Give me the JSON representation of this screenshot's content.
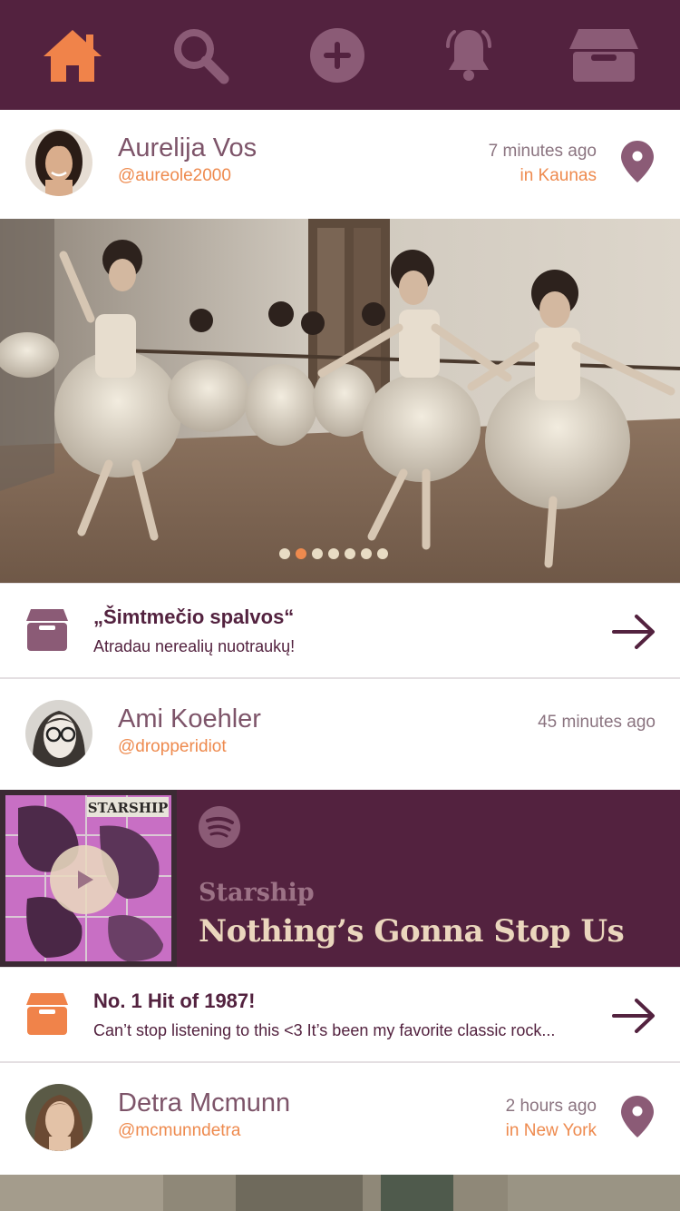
{
  "nav": {
    "items": [
      {
        "icon": "home-icon",
        "active": true
      },
      {
        "icon": "search-icon",
        "active": false
      },
      {
        "icon": "plus-circle-icon",
        "active": false
      },
      {
        "icon": "bell-icon",
        "active": false
      },
      {
        "icon": "box-icon",
        "active": false
      }
    ],
    "colors": {
      "active": "#f0834a",
      "inactive": "#8b5b76",
      "background": "#53223f"
    }
  },
  "posts": [
    {
      "author": "Aurelija Vos",
      "handle": "@aureole2000",
      "time": "7 minutes ago",
      "location": "in Kaunas",
      "carousel": {
        "slides": 7,
        "active_index": 1
      },
      "collection": {
        "icon": "box-icon",
        "title": "„Šimtmečio spalvos“",
        "description": "Atradau nerealių nuotraukų!"
      }
    },
    {
      "author": "Ami Koehler",
      "handle": "@dropperidiot",
      "time": "45 minutes ago",
      "music": {
        "service_icon": "spotify-icon",
        "album_label": "STARSHIP",
        "artist": "Starship",
        "track": "Nothing’s Gonna Stop Us"
      },
      "collection": {
        "icon": "box-icon",
        "title": "No. 1 Hit of 1987!",
        "description": "Can’t stop listening to this <3 It’s been my favorite classic rock..."
      }
    },
    {
      "author": "Detra Mcmunn",
      "handle": "@mcmunndetra",
      "time": "2 hours ago",
      "location": "in New York"
    }
  ],
  "colors": {
    "brand": "#53223f",
    "accent": "#ee8a4e",
    "name": "#7d5469",
    "track": "#ead6bd"
  }
}
